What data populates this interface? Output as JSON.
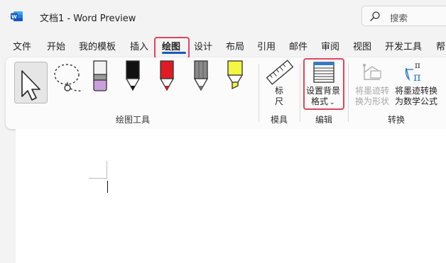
{
  "window": {
    "title": "文档1  -  Word Preview",
    "app_icon": "word-icon",
    "search_placeholder": "搜索"
  },
  "menu": {
    "tabs": [
      "文件",
      "开始",
      "我的模板",
      "插入",
      "绘图",
      "设计",
      "布局",
      "引用",
      "邮件",
      "审阅",
      "视图",
      "开发工具",
      "帮"
    ],
    "active_tab": "绘图"
  },
  "ribbon": {
    "groups": {
      "drawing_tools": "绘图工具",
      "stencils": "模具",
      "edit": "编辑",
      "convert": "转换"
    },
    "tools": [
      {
        "name": "select-tool",
        "icon": "cursor-arrow-icon"
      },
      {
        "name": "lasso-tool",
        "icon": "lasso-select-icon"
      },
      {
        "name": "eraser-tool",
        "icon": "eraser-icon",
        "color": "#c9a0dc"
      },
      {
        "name": "pen-black",
        "icon": "pen-icon",
        "color": "#111111"
      },
      {
        "name": "pen-red",
        "icon": "pen-icon",
        "color": "#e01b24"
      },
      {
        "name": "pencil-gray",
        "icon": "pencil-icon",
        "color": "#8a8a8a"
      },
      {
        "name": "highlighter-yellow",
        "icon": "highlighter-icon",
        "color": "#f5f542"
      }
    ],
    "ruler_label_1": "标",
    "ruler_label_2": "尺",
    "background_format_line1": "设置背景",
    "background_format_line2": "格式",
    "ink_to_shape_line1": "将墨迹转",
    "ink_to_shape_line2": "换为形状",
    "ink_to_math_line1": "将墨迹转换",
    "ink_to_math_line2": "为数学公式"
  },
  "colors": {
    "highlight": "#e0455c",
    "accent": "#185abd"
  }
}
